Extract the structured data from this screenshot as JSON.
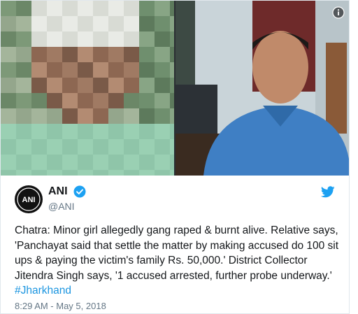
{
  "media": {
    "info_icon": "info-circle-icon"
  },
  "tweet": {
    "display_name": "ANI",
    "handle": "@ANI",
    "avatar_text": "ANI",
    "verified_icon": "verified-badge-icon",
    "logo_icon": "twitter-bird-icon",
    "text": "Chatra: Minor girl allegedly gang raped & burnt alive. Relative says, 'Panchayat said that settle the matter by making accused do 100 sit ups & paying the victim's family Rs. 50,000.' District Collector Jitendra Singh says, '1 accused arrested, further probe underway.' ",
    "hashtag": "#Jharkhand",
    "timestamp": "8:29 AM - May 5, 2018"
  },
  "colors": {
    "link": "#1b95e0",
    "verified": "#1da1f2",
    "secondary_text": "#657786",
    "border": "#e1e8ed"
  }
}
